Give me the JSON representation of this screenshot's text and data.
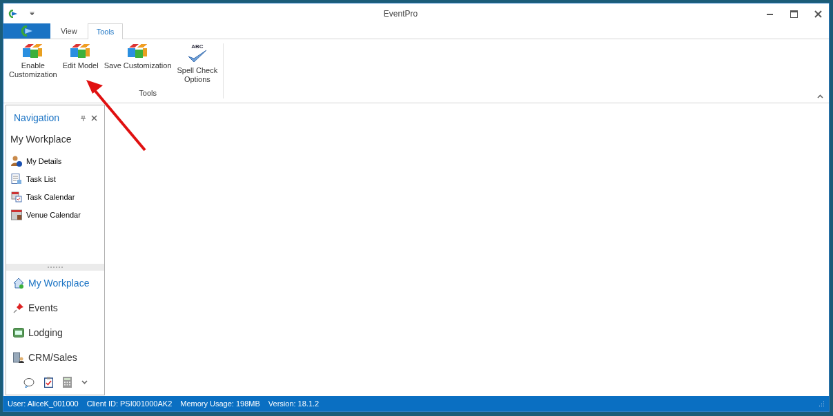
{
  "window": {
    "title": "EventPro"
  },
  "tabs": [
    {
      "label": "View",
      "selected": false
    },
    {
      "label": "Tools",
      "selected": true
    }
  ],
  "ribbon": {
    "group_label": "Tools",
    "buttons": [
      {
        "label": "Enable\nCustomization",
        "kind": "blocks"
      },
      {
        "label": "Edit Model",
        "kind": "blocks"
      },
      {
        "label": "Save Customization",
        "kind": "blocks"
      },
      {
        "label": "Spell Check\nOptions",
        "kind": "spellcheck",
        "icon_text": "ABC"
      }
    ]
  },
  "navigation": {
    "title": "Navigation",
    "section_title": "My Workplace",
    "items": [
      {
        "label": "My Details",
        "kind": "person"
      },
      {
        "label": "Task List",
        "kind": "list"
      },
      {
        "label": "Task Calendar",
        "kind": "taskcal"
      },
      {
        "label": "Venue Calendar",
        "kind": "calendar"
      }
    ],
    "modules": [
      {
        "label": "My Workplace",
        "kind": "home",
        "selected": true
      },
      {
        "label": "Events",
        "kind": "pin",
        "selected": false
      },
      {
        "label": "Lodging",
        "kind": "bed",
        "selected": false
      },
      {
        "label": "CRM/Sales",
        "kind": "crm",
        "selected": false
      }
    ]
  },
  "status_bar": [
    "User: AliceK_001000",
    "Client ID: PSI001000AK2",
    "Memory Usage: 198MB",
    "Version: 18.1.2"
  ]
}
